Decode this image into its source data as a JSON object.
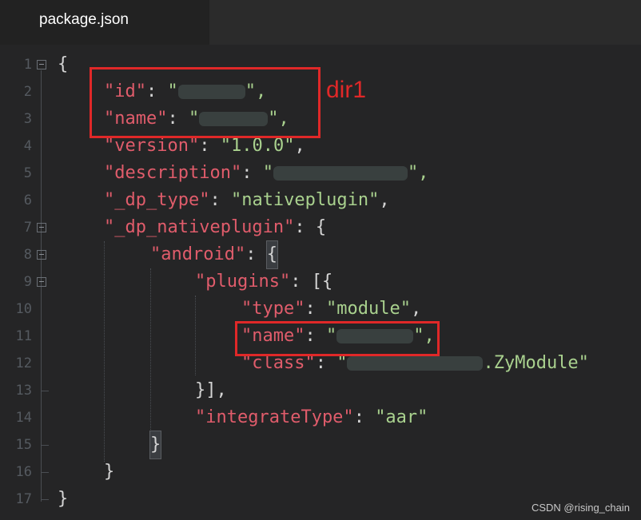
{
  "tab": {
    "title": "package.json"
  },
  "gutter": [
    "1",
    "2",
    "3",
    "4",
    "5",
    "6",
    "7",
    "8",
    "9",
    "10",
    "11",
    "12",
    "13",
    "14",
    "15",
    "16",
    "17"
  ],
  "code": {
    "l1": "{",
    "l2_key": "\"id\"",
    "l2_q1": "\"",
    "l2_q2": "\",",
    "l3_key": "\"name\"",
    "l3_q1": "\"",
    "l3_q2": "\",",
    "l4_key": "\"version\"",
    "l4_val": "\"1.0.0\"",
    "l5_key": "\"description\"",
    "l5_q1": "\"",
    "l5_q2": "\",",
    "l6_key": "\"_dp_type\"",
    "l6_val": "\"nativeplugin\"",
    "l7_key": "\"_dp_nativeplugin\"",
    "l8_key": "\"android\"",
    "l9_key": "\"plugins\"",
    "l10_key": "\"type\"",
    "l10_val": "\"module\"",
    "l11_key": "\"name\"",
    "l11_q1": "\"",
    "l11_q2": "\",",
    "l12_key": "\"class\"",
    "l12_q1": "\"",
    "l12_val": ".ZyModule\"",
    "l13": "}],",
    "l14_key": "\"integrateType\"",
    "l14_val": "\"aar\"",
    "l15": "}",
    "l16": "}",
    "l17": "}"
  },
  "annotation": {
    "label": "dir1",
    "color": "#e02828"
  },
  "watermark": "CSDN @rising_chain"
}
